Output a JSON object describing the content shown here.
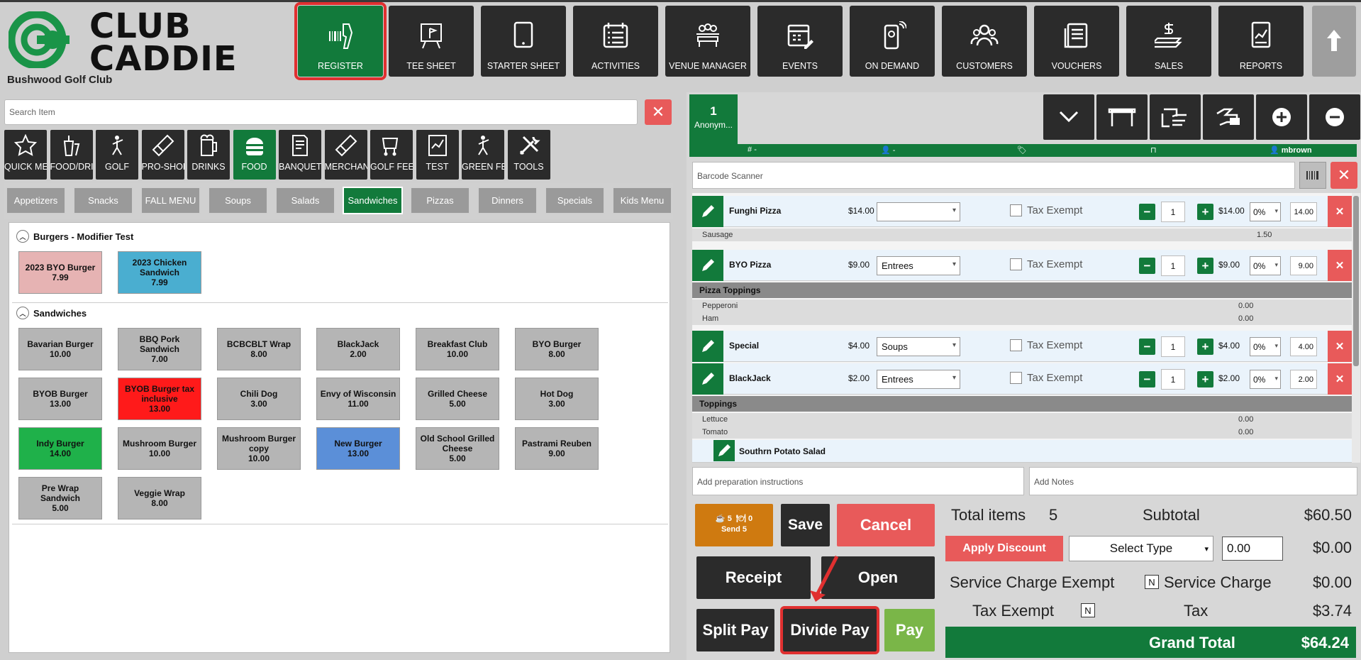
{
  "brand": {
    "line1": "CLUB",
    "line2": "CADDIE",
    "club_name": "Bushwood Golf Club"
  },
  "nav": [
    {
      "label": "REGISTER",
      "icon": "barcode-scanner-icon"
    },
    {
      "label": "TEE SHEET",
      "icon": "flag-board-icon"
    },
    {
      "label": "STARTER SHEET",
      "icon": "tablet-icon"
    },
    {
      "label": "ACTIVITIES",
      "icon": "calendar-list-icon"
    },
    {
      "label": "VENUE MANAGER",
      "icon": "people-table-icon"
    },
    {
      "label": "EVENTS",
      "icon": "calendar-edit-icon"
    },
    {
      "label": "ON DEMAND",
      "icon": "phone-signal-icon"
    },
    {
      "label": "CUSTOMERS",
      "icon": "customers-icon"
    },
    {
      "label": "VOUCHERS",
      "icon": "voucher-icon"
    },
    {
      "label": "SALES",
      "icon": "money-icon"
    },
    {
      "label": "REPORTS",
      "icon": "report-chart-icon"
    }
  ],
  "search": {
    "placeholder": "Search Item"
  },
  "categories": [
    "QUICK MENU",
    "FOOD/DRINK",
    "GOLF",
    "PRO-SHOP",
    "DRINKS",
    "FOOD",
    "BANQUET",
    "MERCHANDISE",
    "GOLF FEES",
    "TEST",
    "GREEN FEES",
    "TOOLS"
  ],
  "subcategories": [
    "Appetizers",
    "Snacks",
    "FALL MENU",
    "Soups",
    "Salads",
    "Sandwiches",
    "Pizzas",
    "Dinners",
    "Specials",
    "Kids Menu"
  ],
  "sections": {
    "burgers": {
      "title": "Burgers - Modifier Test",
      "items": [
        {
          "name": "2023 BYO Burger",
          "price": "7.99"
        },
        {
          "name": "2023 Chicken Sandwich",
          "price": "7.99"
        }
      ]
    },
    "sandwiches": {
      "title": "Sandwiches",
      "items": [
        {
          "name": "Bavarian Burger",
          "price": "10.00"
        },
        {
          "name": "BBQ Pork Sandwich",
          "price": "7.00"
        },
        {
          "name": "BCBCBLT Wrap",
          "price": "8.00"
        },
        {
          "name": "BlackJack",
          "price": "2.00"
        },
        {
          "name": "Breakfast Club",
          "price": "10.00"
        },
        {
          "name": "BYO Burger",
          "price": "8.00"
        },
        {
          "name": "BYOB Burger",
          "price": "13.00"
        },
        {
          "name": "BYOB Burger tax inclusive",
          "price": "13.00"
        },
        {
          "name": "Chili Dog",
          "price": "3.00"
        },
        {
          "name": "Envy of Wisconsin",
          "price": "11.00"
        },
        {
          "name": "Grilled Cheese",
          "price": "5.00"
        },
        {
          "name": "Hot Dog",
          "price": "3.00"
        },
        {
          "name": "Indy Burger",
          "price": "14.00"
        },
        {
          "name": "Mushroom Burger",
          "price": "10.00"
        },
        {
          "name": "Mushroom Burger copy",
          "price": "10.00"
        },
        {
          "name": "New Burger",
          "price": "13.00"
        },
        {
          "name": "Old School Grilled Cheese",
          "price": "5.00"
        },
        {
          "name": "Pastrami Reuben",
          "price": "9.00"
        },
        {
          "name": "Pre Wrap Sandwich",
          "price": "5.00"
        },
        {
          "name": "Veggie Wrap",
          "price": "8.00"
        }
      ]
    }
  },
  "ticket": {
    "number": "1",
    "name": "Anonym..."
  },
  "ticket_header": {
    "table": "-",
    "guest": "-",
    "user": "mbrown"
  },
  "barcode": {
    "placeholder": "Barcode Scanner"
  },
  "orders": [
    {
      "name": "Funghi Pizza",
      "price": "$14.00",
      "type": "",
      "tax_label": "Tax Exempt",
      "qty": "1",
      "line_price": "$14.00",
      "pct": "0%",
      "amount": "14.00"
    },
    {
      "name": "BYO Pizza",
      "price": "$9.00",
      "type": "Entrees",
      "tax_label": "Tax Exempt",
      "qty": "1",
      "line_price": "$9.00",
      "pct": "0%",
      "amount": "9.00"
    },
    {
      "name": "Special",
      "price": "$4.00",
      "type": "Soups",
      "tax_label": "Tax Exempt",
      "qty": "1",
      "line_price": "$4.00",
      "pct": "0%",
      "amount": "4.00"
    },
    {
      "name": "BlackJack",
      "price": "$2.00",
      "type": "Entrees",
      "tax_label": "Tax Exempt",
      "qty": "1",
      "line_price": "$2.00",
      "pct": "0%",
      "amount": "2.00"
    }
  ],
  "modifiers": {
    "sausage": {
      "name": "Sausage",
      "value": "1.50"
    },
    "pizza_toppings": "Pizza Toppings",
    "pepperoni": {
      "name": "Pepperoni",
      "value": "0.00"
    },
    "ham": {
      "name": "Ham",
      "value": "0.00"
    },
    "toppings": "Toppings",
    "lettuce": {
      "name": "Lettuce",
      "value": "0.00"
    },
    "tomato": {
      "name": "Tomato",
      "value": "0.00"
    },
    "side": "Southrn Potato Salad"
  },
  "prep": {
    "placeholder": "Add preparation instructions"
  },
  "notes": {
    "placeholder": "Add Notes"
  },
  "send": {
    "count_a": "5",
    "count_b": "0",
    "label": "Send 5"
  },
  "actions": {
    "save": "Save",
    "cancel": "Cancel",
    "receipt": "Receipt",
    "open": "Open",
    "split_pay": "Split Pay",
    "divide_pay": "Divide Pay",
    "pay": "Pay"
  },
  "totals": {
    "total_items_label": "Total items",
    "total_items": "5",
    "subtotal_label": "Subtotal",
    "subtotal": "$60.50",
    "apply_discount": "Apply Discount",
    "select_type": "Select Type",
    "discount_input": "0.00",
    "discount": "$0.00",
    "service_exempt_label": "Service Charge Exempt",
    "service_exempt_flag": "N",
    "service_charge_label": "Service Charge",
    "service_charge": "$0.00",
    "tax_exempt_label": "Tax Exempt",
    "tax_exempt_flag": "N",
    "tax_label": "Tax",
    "tax": "$3.74",
    "grand_total_label": "Grand Total",
    "grand_total": "$64.24"
  },
  "colors": {
    "brand_green": "#127a3b",
    "danger": "#e85a5a",
    "highlight": "#e03030",
    "send_orange": "#cf7a10",
    "pay_green": "#7ab648"
  }
}
